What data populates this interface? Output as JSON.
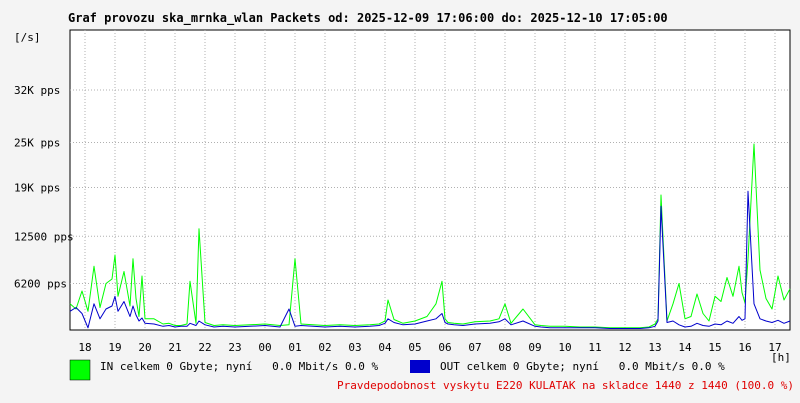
{
  "page": {
    "title": "Graf provozu ska_mrnka_wlan Packets od: 2025-12-09 17:06:00 do: 2025-12-10 17:05:00",
    "probability": "Pravdepodobnost vyskytu E220 KULATAK na skladce 1440 z 1440 (100.0 %)"
  },
  "legend": [
    {
      "label": "IN celkem 0 Gbyte; nyní   0.0 Mbit/s 0.0 %",
      "color": "#00ff00"
    },
    {
      "label": "OUT celkem 0 Gbyte; nyní   0.0 Mbit/s 0.0 %",
      "color": "#0000cc"
    }
  ],
  "chart_data": {
    "type": "line",
    "title": "Graf provozu ska_mrnka_wlan Packets od: 2025-12-09 17:06:00 do: 2025-12-10 17:05:00",
    "ylabel": "[/s]",
    "xlabel": "[h]",
    "ylim": [
      0,
      40000
    ],
    "xlim": [
      17.5,
      41.5
    ],
    "x_ticks": [
      {
        "value": 18,
        "label": "18"
      },
      {
        "value": 19,
        "label": "19"
      },
      {
        "value": 20,
        "label": "20"
      },
      {
        "value": 21,
        "label": "21"
      },
      {
        "value": 22,
        "label": "22"
      },
      {
        "value": 23,
        "label": "23"
      },
      {
        "value": 24,
        "label": "00"
      },
      {
        "value": 25,
        "label": "01"
      },
      {
        "value": 26,
        "label": "02"
      },
      {
        "value": 27,
        "label": "03"
      },
      {
        "value": 28,
        "label": "04"
      },
      {
        "value": 29,
        "label": "05"
      },
      {
        "value": 30,
        "label": "06"
      },
      {
        "value": 31,
        "label": "07"
      },
      {
        "value": 32,
        "label": "08"
      },
      {
        "value": 33,
        "label": "09"
      },
      {
        "value": 34,
        "label": "10"
      },
      {
        "value": 35,
        "label": "11"
      },
      {
        "value": 36,
        "label": "12"
      },
      {
        "value": 37,
        "label": "13"
      },
      {
        "value": 38,
        "label": "14"
      },
      {
        "value": 39,
        "label": "15"
      },
      {
        "value": 40,
        "label": "16"
      },
      {
        "value": 41,
        "label": "17"
      }
    ],
    "y_ticks": [
      {
        "value": 6200,
        "label": "6200 pps"
      },
      {
        "value": 12500,
        "label": "12500 pps"
      },
      {
        "value": 19000,
        "label": "19K pps"
      },
      {
        "value": 25000,
        "label": "25K pps"
      },
      {
        "value": 32000,
        "label": "32K pps"
      }
    ],
    "grid": true,
    "legend_position": "bottom-left",
    "series": [
      {
        "name": "IN",
        "color": "#00ff00",
        "x": [
          17.5,
          17.7,
          17.9,
          18.1,
          18.3,
          18.5,
          18.7,
          18.9,
          19.0,
          19.1,
          19.3,
          19.5,
          19.6,
          19.7,
          19.8,
          19.9,
          20.0,
          20.3,
          20.6,
          20.8,
          21.0,
          21.2,
          21.4,
          21.5,
          21.7,
          21.8,
          22.0,
          22.3,
          22.6,
          23.0,
          23.5,
          24.0,
          24.5,
          24.8,
          25.0,
          25.2,
          25.6,
          26.0,
          26.5,
          27.0,
          27.5,
          27.8,
          28.0,
          28.1,
          28.3,
          28.6,
          29.0,
          29.4,
          29.7,
          29.9,
          30.0,
          30.1,
          30.3,
          30.6,
          31.0,
          31.5,
          31.8,
          32.0,
          32.2,
          32.6,
          33.0,
          33.2,
          33.5,
          34.0,
          34.5,
          35.0,
          35.5,
          36.0,
          36.5,
          36.8,
          37.0,
          37.1,
          37.2,
          37.4,
          37.6,
          37.8,
          38.0,
          38.2,
          38.4,
          38.6,
          38.8,
          39.0,
          39.2,
          39.4,
          39.6,
          39.8,
          39.9,
          40.0,
          40.1,
          40.3,
          40.5,
          40.7,
          40.9,
          41.1,
          41.3,
          41.5
        ],
        "values": [
          3500,
          2800,
          5200,
          2500,
          8500,
          3000,
          6200,
          6800,
          10000,
          4500,
          7800,
          3200,
          9500,
          4200,
          1800,
          7200,
          1500,
          1500,
          800,
          900,
          600,
          600,
          800,
          6500,
          900,
          13500,
          1000,
          600,
          700,
          600,
          700,
          800,
          600,
          700,
          9500,
          800,
          700,
          600,
          700,
          600,
          700,
          800,
          1200,
          4000,
          1400,
          900,
          1200,
          1800,
          3500,
          6500,
          1500,
          1000,
          900,
          800,
          1100,
          1200,
          1500,
          3500,
          900,
          2800,
          700,
          600,
          500,
          500,
          400,
          400,
          300,
          300,
          300,
          400,
          800,
          1500,
          18000,
          1200,
          3500,
          6200,
          1500,
          1800,
          4800,
          2200,
          1200,
          4500,
          3800,
          7000,
          4500,
          8500,
          5000,
          3600,
          9500,
          24800,
          8000,
          4200,
          2800,
          7200,
          4000,
          5500
        ]
      },
      {
        "name": "OUT",
        "color": "#0000cc",
        "x": [
          17.5,
          17.7,
          17.9,
          18.1,
          18.3,
          18.5,
          18.7,
          18.9,
          19.0,
          19.1,
          19.3,
          19.5,
          19.6,
          19.7,
          19.8,
          19.9,
          20.0,
          20.3,
          20.6,
          20.8,
          21.0,
          21.2,
          21.4,
          21.5,
          21.7,
          21.8,
          22.0,
          22.3,
          22.6,
          23.0,
          23.5,
          24.0,
          24.5,
          24.8,
          25.0,
          25.2,
          25.6,
          26.0,
          26.5,
          27.0,
          27.5,
          27.8,
          28.0,
          28.1,
          28.3,
          28.6,
          29.0,
          29.4,
          29.7,
          29.9,
          30.0,
          30.1,
          30.3,
          30.6,
          31.0,
          31.5,
          31.8,
          32.0,
          32.2,
          32.6,
          33.0,
          33.2,
          33.5,
          34.0,
          34.5,
          35.0,
          35.5,
          36.0,
          36.5,
          36.8,
          37.0,
          37.1,
          37.2,
          37.4,
          37.6,
          37.8,
          38.0,
          38.2,
          38.4,
          38.6,
          38.8,
          39.0,
          39.2,
          39.4,
          39.6,
          39.8,
          39.9,
          40.0,
          40.1,
          40.3,
          40.5,
          40.7,
          40.9,
          41.1,
          41.3,
          41.5
        ],
        "values": [
          2500,
          3000,
          2200,
          300,
          3500,
          1500,
          2800,
          3200,
          4500,
          2500,
          3800,
          1800,
          3200,
          2000,
          1200,
          1600,
          900,
          800,
          500,
          600,
          400,
          500,
          500,
          900,
          600,
          1200,
          700,
          400,
          500,
          400,
          500,
          600,
          400,
          2800,
          500,
          600,
          500,
          400,
          500,
          400,
          500,
          600,
          900,
          1500,
          1000,
          700,
          800,
          1200,
          1500,
          2200,
          1000,
          800,
          700,
          600,
          800,
          900,
          1100,
          1500,
          700,
          1200,
          500,
          400,
          300,
          300,
          300,
          300,
          200,
          200,
          200,
          300,
          500,
          1200,
          16500,
          1000,
          1200,
          700,
          400,
          500,
          900,
          600,
          500,
          800,
          700,
          1200,
          900,
          1800,
          1300,
          1500,
          18500,
          3500,
          1500,
          1200,
          1000,
          1300,
          900,
          1200
        ]
      }
    ]
  }
}
